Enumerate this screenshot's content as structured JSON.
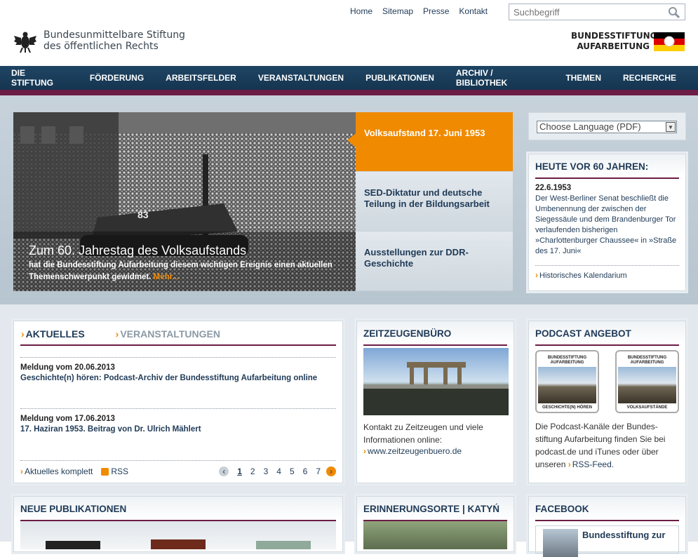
{
  "header": {
    "top_links": [
      "Home",
      "Sitemap",
      "Presse",
      "Kontakt"
    ],
    "search_placeholder": "Suchbegriff",
    "claim_line1": "Bundesunmittelbare Stiftung",
    "claim_line2": "des öffentlichen Rechts",
    "brand_line1": "BUNDESSTIFTUNG",
    "brand_line2": "AUFARBEITUNG",
    "flag_colors": [
      "#000000",
      "#dd0000",
      "#ffce00"
    ]
  },
  "nav": {
    "items": [
      "DIE STIFTUNG",
      "FÖRDERUNG",
      "ARBEITSFELDER",
      "VERANSTALTUNGEN",
      "PUBLIKATIONEN",
      "ARCHIV / BIBLIOTHEK",
      "THEMEN",
      "RECHERCHE"
    ]
  },
  "hero": {
    "title": "Zum 60. Jahrestag des Volksaufstands",
    "text": "hat die Bundesstiftung Aufarbeitung diesem wichtigen Ereignis einen aktuellen Themenschwerpunkt gewidmet.",
    "more": "Mehr...",
    "tank_number": "83",
    "tabs": [
      "Volksaufstand 17. Juni 1953",
      "SED-Diktatur und deutsche Teilung in der Bildungsarbeit",
      "Ausstellungen zur DDR-Geschichte"
    ]
  },
  "language": {
    "selected": "Choose Language (PDF)"
  },
  "heute": {
    "heading": "HEUTE VOR 60 JAHREN:",
    "date": "22.6.1953",
    "text": "Der West-Berliner Senat beschließt die Umbenennung der zwischen der Siegessäule und dem Brandenburger Tor verlaufenden bisherigen »Charlottenburger Chaussee« in »Straße des 17. Juni«",
    "link": "Historisches Kalendarium"
  },
  "news": {
    "tab_active": "AKTUELLES",
    "tab_inactive": "VERANSTALTUNGEN",
    "items": [
      {
        "meta": "Meldung vom 20.06.2013",
        "headline": "Geschichte(n) hören: Podcast-Archiv der Bundesstiftung Aufarbeitung online"
      },
      {
        "meta": "Meldung vom 17.06.2013",
        "headline": "17. Haziran 1953. Beitrag von Dr. Ulrich Mählert"
      }
    ],
    "all_link": "Aktuelles komplett",
    "rss": "RSS",
    "pages": [
      "1",
      "2",
      "3",
      "4",
      "5",
      "6",
      "7"
    ]
  },
  "zeitzeugen": {
    "heading": "ZEITZEUGENBÜRO",
    "text": "Kontakt zu Zeitzeugen und viele Informationen online:",
    "link": "www.zeitzeugenbuero.de"
  },
  "podcast": {
    "heading": "PODCAST ANGEBOT",
    "cover_brand": "BUNDESSTIFTUNG AUFARBEITUNG",
    "cover1_label": "GESCHICHTE(N) HÖREN",
    "cover2_label": "VOLKSAUFSTÄNDE",
    "text": "Die Podcast-Kanäle der Bundes-stiftung Aufarbeitung finden Sie bei podcast.de und iTunes oder über unseren",
    "link": "RSS-Feed."
  },
  "bottom": {
    "pub_heading": "NEUE PUBLIKATIONEN",
    "ort_heading": "ERINNERUNGSORTE | KATYŃ",
    "fb_heading": "FACEBOOK",
    "fb_page": "Bundesstiftung zur"
  }
}
